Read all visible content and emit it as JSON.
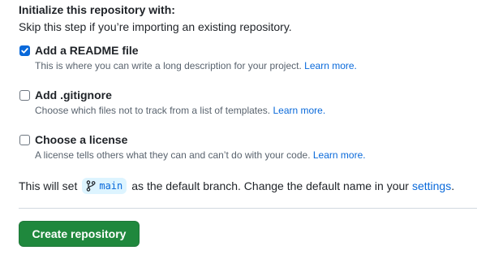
{
  "init": {
    "heading": "Initialize this repository with:",
    "subheading": "Skip this step if you’re importing an existing repository."
  },
  "options": [
    {
      "title": "Add a README file",
      "description": "This is where you can write a long description for your project.",
      "link": "Learn more.",
      "checked": true
    },
    {
      "title": "Add .gitignore",
      "description": "Choose which files not to track from a list of templates.",
      "link": "Learn more.",
      "checked": false
    },
    {
      "title": "Choose a license",
      "description": "A license tells others what they can and can’t do with your code.",
      "link": "Learn more.",
      "checked": false
    }
  ],
  "branch": {
    "prefix": "This will set",
    "name": "main",
    "middle": "as the default branch. Change the default name in your",
    "settings_link": "settings",
    "suffix": "."
  },
  "actions": {
    "create_label": "Create repository"
  },
  "colors": {
    "accent": "#0969da",
    "button": "#1f883d"
  }
}
